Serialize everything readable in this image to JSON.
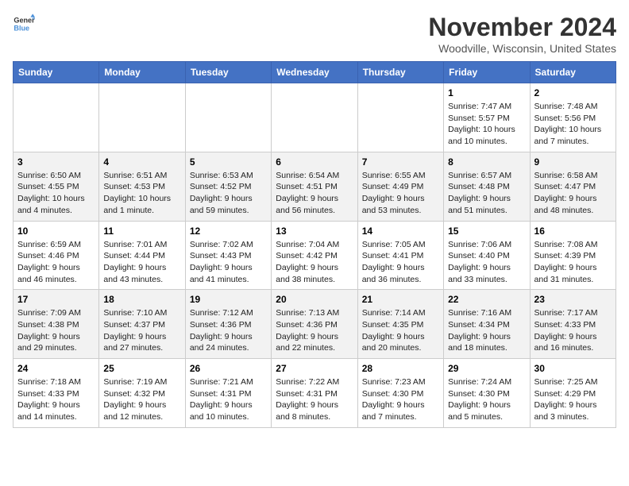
{
  "logo": {
    "line1": "General",
    "line2": "Blue"
  },
  "title": "November 2024",
  "location": "Woodville, Wisconsin, United States",
  "headers": [
    "Sunday",
    "Monday",
    "Tuesday",
    "Wednesday",
    "Thursday",
    "Friday",
    "Saturday"
  ],
  "weeks": [
    [
      {
        "day": "",
        "info": ""
      },
      {
        "day": "",
        "info": ""
      },
      {
        "day": "",
        "info": ""
      },
      {
        "day": "",
        "info": ""
      },
      {
        "day": "",
        "info": ""
      },
      {
        "day": "1",
        "info": "Sunrise: 7:47 AM\nSunset: 5:57 PM\nDaylight: 10 hours and 10 minutes."
      },
      {
        "day": "2",
        "info": "Sunrise: 7:48 AM\nSunset: 5:56 PM\nDaylight: 10 hours and 7 minutes."
      }
    ],
    [
      {
        "day": "3",
        "info": "Sunrise: 6:50 AM\nSunset: 4:55 PM\nDaylight: 10 hours and 4 minutes."
      },
      {
        "day": "4",
        "info": "Sunrise: 6:51 AM\nSunset: 4:53 PM\nDaylight: 10 hours and 1 minute."
      },
      {
        "day": "5",
        "info": "Sunrise: 6:53 AM\nSunset: 4:52 PM\nDaylight: 9 hours and 59 minutes."
      },
      {
        "day": "6",
        "info": "Sunrise: 6:54 AM\nSunset: 4:51 PM\nDaylight: 9 hours and 56 minutes."
      },
      {
        "day": "7",
        "info": "Sunrise: 6:55 AM\nSunset: 4:49 PM\nDaylight: 9 hours and 53 minutes."
      },
      {
        "day": "8",
        "info": "Sunrise: 6:57 AM\nSunset: 4:48 PM\nDaylight: 9 hours and 51 minutes."
      },
      {
        "day": "9",
        "info": "Sunrise: 6:58 AM\nSunset: 4:47 PM\nDaylight: 9 hours and 48 minutes."
      }
    ],
    [
      {
        "day": "10",
        "info": "Sunrise: 6:59 AM\nSunset: 4:46 PM\nDaylight: 9 hours and 46 minutes."
      },
      {
        "day": "11",
        "info": "Sunrise: 7:01 AM\nSunset: 4:44 PM\nDaylight: 9 hours and 43 minutes."
      },
      {
        "day": "12",
        "info": "Sunrise: 7:02 AM\nSunset: 4:43 PM\nDaylight: 9 hours and 41 minutes."
      },
      {
        "day": "13",
        "info": "Sunrise: 7:04 AM\nSunset: 4:42 PM\nDaylight: 9 hours and 38 minutes."
      },
      {
        "day": "14",
        "info": "Sunrise: 7:05 AM\nSunset: 4:41 PM\nDaylight: 9 hours and 36 minutes."
      },
      {
        "day": "15",
        "info": "Sunrise: 7:06 AM\nSunset: 4:40 PM\nDaylight: 9 hours and 33 minutes."
      },
      {
        "day": "16",
        "info": "Sunrise: 7:08 AM\nSunset: 4:39 PM\nDaylight: 9 hours and 31 minutes."
      }
    ],
    [
      {
        "day": "17",
        "info": "Sunrise: 7:09 AM\nSunset: 4:38 PM\nDaylight: 9 hours and 29 minutes."
      },
      {
        "day": "18",
        "info": "Sunrise: 7:10 AM\nSunset: 4:37 PM\nDaylight: 9 hours and 27 minutes."
      },
      {
        "day": "19",
        "info": "Sunrise: 7:12 AM\nSunset: 4:36 PM\nDaylight: 9 hours and 24 minutes."
      },
      {
        "day": "20",
        "info": "Sunrise: 7:13 AM\nSunset: 4:36 PM\nDaylight: 9 hours and 22 minutes."
      },
      {
        "day": "21",
        "info": "Sunrise: 7:14 AM\nSunset: 4:35 PM\nDaylight: 9 hours and 20 minutes."
      },
      {
        "day": "22",
        "info": "Sunrise: 7:16 AM\nSunset: 4:34 PM\nDaylight: 9 hours and 18 minutes."
      },
      {
        "day": "23",
        "info": "Sunrise: 7:17 AM\nSunset: 4:33 PM\nDaylight: 9 hours and 16 minutes."
      }
    ],
    [
      {
        "day": "24",
        "info": "Sunrise: 7:18 AM\nSunset: 4:33 PM\nDaylight: 9 hours and 14 minutes."
      },
      {
        "day": "25",
        "info": "Sunrise: 7:19 AM\nSunset: 4:32 PM\nDaylight: 9 hours and 12 minutes."
      },
      {
        "day": "26",
        "info": "Sunrise: 7:21 AM\nSunset: 4:31 PM\nDaylight: 9 hours and 10 minutes."
      },
      {
        "day": "27",
        "info": "Sunrise: 7:22 AM\nSunset: 4:31 PM\nDaylight: 9 hours and 8 minutes."
      },
      {
        "day": "28",
        "info": "Sunrise: 7:23 AM\nSunset: 4:30 PM\nDaylight: 9 hours and 7 minutes."
      },
      {
        "day": "29",
        "info": "Sunrise: 7:24 AM\nSunset: 4:30 PM\nDaylight: 9 hours and 5 minutes."
      },
      {
        "day": "30",
        "info": "Sunrise: 7:25 AM\nSunset: 4:29 PM\nDaylight: 9 hours and 3 minutes."
      }
    ]
  ]
}
